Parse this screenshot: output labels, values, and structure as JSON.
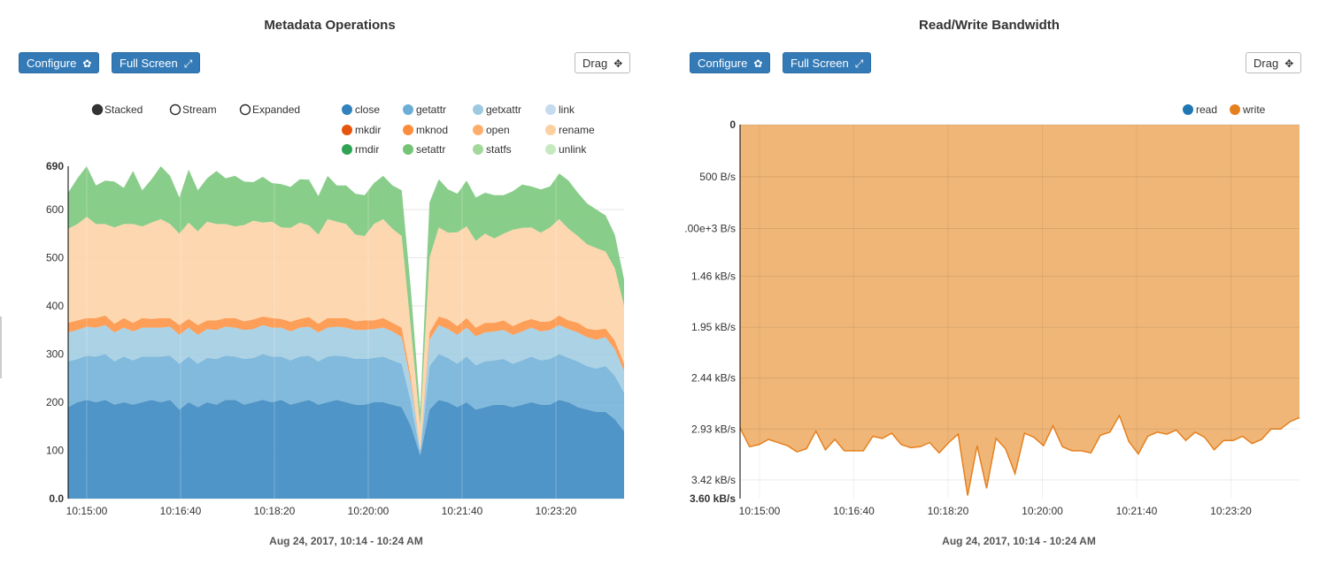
{
  "left": {
    "title": "Metadata Operations",
    "configure_label": "Configure",
    "fullscreen_label": "Full Screen",
    "drag_label": "Drag",
    "icons": {
      "configure": "gear-icon",
      "fullscreen": "expand-icon",
      "drag": "move-icon"
    },
    "controls": {
      "stacked": "Stacked",
      "stream": "Stream",
      "expanded": "Expanded",
      "selected": "Stacked"
    },
    "date_range": "Aug 24, 2017, 10:14 - 10:24 AM"
  },
  "right": {
    "title": "Read/Write Bandwidth",
    "configure_label": "Configure",
    "fullscreen_label": "Full Screen",
    "drag_label": "Drag",
    "icons": {
      "configure": "gear-icon",
      "fullscreen": "expand-icon",
      "drag": "move-icon"
    },
    "date_range": "Aug 24, 2017, 10:14 - 10:24 AM"
  },
  "chart_data": [
    {
      "type": "area",
      "stacked": true,
      "x_ticks": [
        "10:15:00",
        "10:16:40",
        "10:18:20",
        "10:20:00",
        "10:21:40",
        "10:23:20"
      ],
      "y_ticks": [
        "0.0",
        "100",
        "200",
        "300",
        "400",
        "500",
        "600",
        "690"
      ],
      "ylim": [
        0,
        690
      ],
      "grid": true,
      "legend_position": "top",
      "series": [
        {
          "name": "close",
          "color": "#3182bd",
          "values": [
            190,
            200,
            205,
            200,
            205,
            195,
            200,
            195,
            200,
            205,
            200,
            205,
            185,
            200,
            190,
            200,
            195,
            205,
            205,
            195,
            200,
            205,
            200,
            205,
            195,
            200,
            205,
            195,
            200,
            205,
            200,
            195,
            195,
            200,
            200,
            195,
            190,
            150,
            90,
            185,
            205,
            200,
            190,
            200,
            185,
            190,
            195,
            195,
            190,
            195,
            200,
            195,
            195,
            205,
            200,
            190,
            185,
            180,
            180,
            165,
            140
          ]
        },
        {
          "name": "getattr",
          "color": "#6baed6",
          "values": [
            95,
            90,
            92,
            95,
            95,
            90,
            95,
            92,
            95,
            90,
            95,
            92,
            95,
            95,
            90,
            92,
            95,
            92,
            90,
            95,
            92,
            95,
            95,
            90,
            92,
            95,
            92,
            90,
            95,
            92,
            95,
            95,
            95,
            92,
            95,
            92,
            90,
            50,
            5,
            90,
            95,
            92,
            90,
            95,
            92,
            95,
            92,
            95,
            90,
            92,
            95,
            92,
            95,
            95,
            92,
            95,
            90,
            90,
            95,
            90,
            80
          ]
        },
        {
          "name": "getxattr",
          "color": "#9ecae1",
          "values": [
            60,
            60,
            60,
            60,
            60,
            60,
            60,
            60,
            60,
            60,
            60,
            60,
            60,
            60,
            60,
            60,
            60,
            60,
            60,
            60,
            60,
            60,
            60,
            60,
            60,
            60,
            60,
            60,
            60,
            60,
            60,
            60,
            60,
            60,
            60,
            60,
            55,
            40,
            5,
            55,
            60,
            60,
            60,
            60,
            60,
            60,
            60,
            60,
            60,
            60,
            60,
            60,
            60,
            60,
            60,
            60,
            60,
            60,
            60,
            55,
            45
          ]
        },
        {
          "name": "link",
          "color": "#c6dbef",
          "values": [
            0,
            0,
            0,
            0,
            0,
            0,
            0,
            0,
            0,
            0,
            0,
            0,
            0,
            0,
            0,
            0,
            0,
            0,
            0,
            0,
            0,
            0,
            0,
            0,
            0,
            0,
            0,
            0,
            0,
            0,
            0,
            0,
            0,
            0,
            0,
            0,
            0,
            0,
            0,
            0,
            0,
            0,
            0,
            0,
            0,
            0,
            0,
            0,
            0,
            0,
            0,
            0,
            0,
            0,
            0,
            0,
            0,
            0,
            0,
            0,
            0
          ]
        },
        {
          "name": "mkdir",
          "color": "#e6550d",
          "values": [
            0,
            0,
            0,
            0,
            0,
            0,
            0,
            0,
            0,
            0,
            0,
            0,
            0,
            0,
            0,
            0,
            0,
            0,
            0,
            0,
            0,
            0,
            0,
            0,
            0,
            0,
            0,
            0,
            0,
            0,
            0,
            0,
            0,
            0,
            0,
            0,
            0,
            0,
            0,
            0,
            0,
            0,
            0,
            0,
            0,
            0,
            0,
            0,
            0,
            0,
            0,
            0,
            0,
            0,
            0,
            0,
            0,
            0,
            0,
            0,
            0
          ]
        },
        {
          "name": "mknod",
          "color": "#fd8d3c",
          "values": [
            20,
            20,
            18,
            20,
            20,
            18,
            20,
            18,
            20,
            18,
            20,
            18,
            20,
            18,
            20,
            18,
            20,
            18,
            20,
            18,
            20,
            18,
            20,
            18,
            20,
            18,
            20,
            18,
            20,
            18,
            20,
            18,
            20,
            18,
            20,
            18,
            20,
            10,
            2,
            15,
            18,
            20,
            18,
            20,
            18,
            20,
            18,
            20,
            18,
            20,
            18,
            20,
            18,
            20,
            18,
            20,
            18,
            20,
            18,
            18,
            15
          ]
        },
        {
          "name": "open",
          "color": "#fdae6b",
          "values": [
            0,
            0,
            0,
            0,
            0,
            0,
            0,
            0,
            0,
            0,
            0,
            0,
            0,
            0,
            0,
            0,
            0,
            0,
            0,
            0,
            0,
            0,
            0,
            0,
            0,
            0,
            0,
            0,
            0,
            0,
            0,
            0,
            0,
            0,
            0,
            0,
            0,
            0,
            0,
            0,
            0,
            0,
            0,
            0,
            0,
            0,
            0,
            0,
            0,
            0,
            0,
            0,
            0,
            0,
            0,
            0,
            0,
            0,
            0,
            0,
            0
          ]
        },
        {
          "name": "rename",
          "color": "#fdd0a2",
          "values": [
            195,
            200,
            210,
            195,
            190,
            200,
            195,
            205,
            190,
            200,
            205,
            195,
            190,
            200,
            195,
            205,
            200,
            195,
            190,
            200,
            205,
            195,
            200,
            190,
            195,
            200,
            190,
            185,
            205,
            200,
            195,
            180,
            175,
            200,
            205,
            195,
            190,
            100,
            50,
            155,
            185,
            180,
            195,
            190,
            180,
            185,
            175,
            180,
            200,
            195,
            190,
            185,
            195,
            200,
            190,
            180,
            175,
            170,
            160,
            150,
            120
          ]
        },
        {
          "name": "rmdir",
          "color": "#31a354",
          "values": [
            0,
            0,
            0,
            0,
            0,
            0,
            0,
            0,
            0,
            0,
            0,
            0,
            0,
            0,
            0,
            0,
            0,
            0,
            0,
            0,
            0,
            0,
            0,
            0,
            0,
            0,
            0,
            0,
            0,
            0,
            0,
            0,
            0,
            0,
            0,
            0,
            0,
            0,
            0,
            0,
            0,
            0,
            0,
            0,
            0,
            0,
            0,
            0,
            0,
            0,
            0,
            0,
            0,
            0,
            0,
            0,
            0,
            0,
            0,
            0,
            0
          ]
        },
        {
          "name": "setattr",
          "color": "#74c476",
          "values": [
            75,
            95,
            105,
            80,
            90,
            95,
            75,
            110,
            75,
            90,
            110,
            100,
            75,
            110,
            85,
            90,
            110,
            95,
            105,
            90,
            80,
            95,
            80,
            90,
            85,
            90,
            95,
            80,
            90,
            75,
            80,
            85,
            85,
            85,
            90,
            90,
            95,
            80,
            30,
            115,
            100,
            90,
            80,
            95,
            90,
            85,
            90,
            80,
            80,
            90,
            85,
            90,
            85,
            95,
            100,
            90,
            85,
            80,
            75,
            70,
            55
          ]
        },
        {
          "name": "statfs",
          "color": "#a1d99b",
          "values": [
            0,
            0,
            0,
            0,
            0,
            0,
            0,
            0,
            0,
            0,
            0,
            0,
            0,
            0,
            0,
            0,
            0,
            0,
            0,
            0,
            0,
            0,
            0,
            0,
            0,
            0,
            0,
            0,
            0,
            0,
            0,
            0,
            0,
            0,
            0,
            0,
            0,
            0,
            0,
            0,
            0,
            0,
            0,
            0,
            0,
            0,
            0,
            0,
            0,
            0,
            0,
            0,
            0,
            0,
            0,
            0,
            0,
            0,
            0,
            0,
            0
          ]
        },
        {
          "name": "unlink",
          "color": "#c7e9c0",
          "values": [
            0,
            0,
            0,
            0,
            0,
            0,
            0,
            0,
            0,
            0,
            0,
            0,
            0,
            0,
            0,
            0,
            0,
            0,
            0,
            0,
            0,
            0,
            0,
            0,
            0,
            0,
            0,
            0,
            0,
            0,
            0,
            0,
            0,
            0,
            0,
            0,
            0,
            0,
            0,
            0,
            0,
            0,
            0,
            0,
            0,
            0,
            0,
            0,
            0,
            0,
            0,
            0,
            0,
            0,
            0,
            0,
            0,
            0,
            0,
            0,
            0
          ]
        }
      ]
    },
    {
      "type": "area",
      "x_ticks": [
        "10:15:00",
        "10:16:40",
        "10:18:20",
        "10:20:00",
        "10:21:40",
        "10:23:20"
      ],
      "y_ticks": [
        "0",
        "500 B/s",
        ".00e+3 B/s",
        "1.46 kB/s",
        "1.95 kB/s",
        "2.44 kB/s",
        "2.93 kB/s",
        "3.42 kB/s",
        "3.60 kB/s"
      ],
      "ylim_labels": [
        "0",
        "3.60 kB/s"
      ],
      "y_inverted": true,
      "grid": true,
      "legend_position": "top-right",
      "series": [
        {
          "name": "read",
          "color": "#1f77b4",
          "values": []
        },
        {
          "name": "write",
          "color": "#e6801f",
          "fill": "#efb677",
          "values_kbps": [
            2.92,
            3.1,
            3.08,
            3.03,
            3.06,
            3.09,
            3.15,
            3.12,
            2.95,
            3.13,
            3.03,
            3.14,
            3.14,
            3.14,
            3.0,
            3.02,
            2.97,
            3.08,
            3.11,
            3.1,
            3.06,
            3.16,
            3.06,
            2.98,
            3.57,
            3.09,
            3.5,
            3.02,
            3.12,
            3.36,
            2.97,
            3.01,
            3.09,
            2.9,
            3.1,
            3.14,
            3.14,
            3.16,
            2.99,
            2.96,
            2.8,
            3.05,
            3.17,
            3.0,
            2.96,
            2.98,
            2.94,
            3.04,
            2.96,
            3.01,
            3.13,
            3.04,
            3.04,
            3.0,
            3.07,
            3.03,
            2.93,
            2.93,
            2.86,
            2.82
          ]
        }
      ]
    }
  ]
}
